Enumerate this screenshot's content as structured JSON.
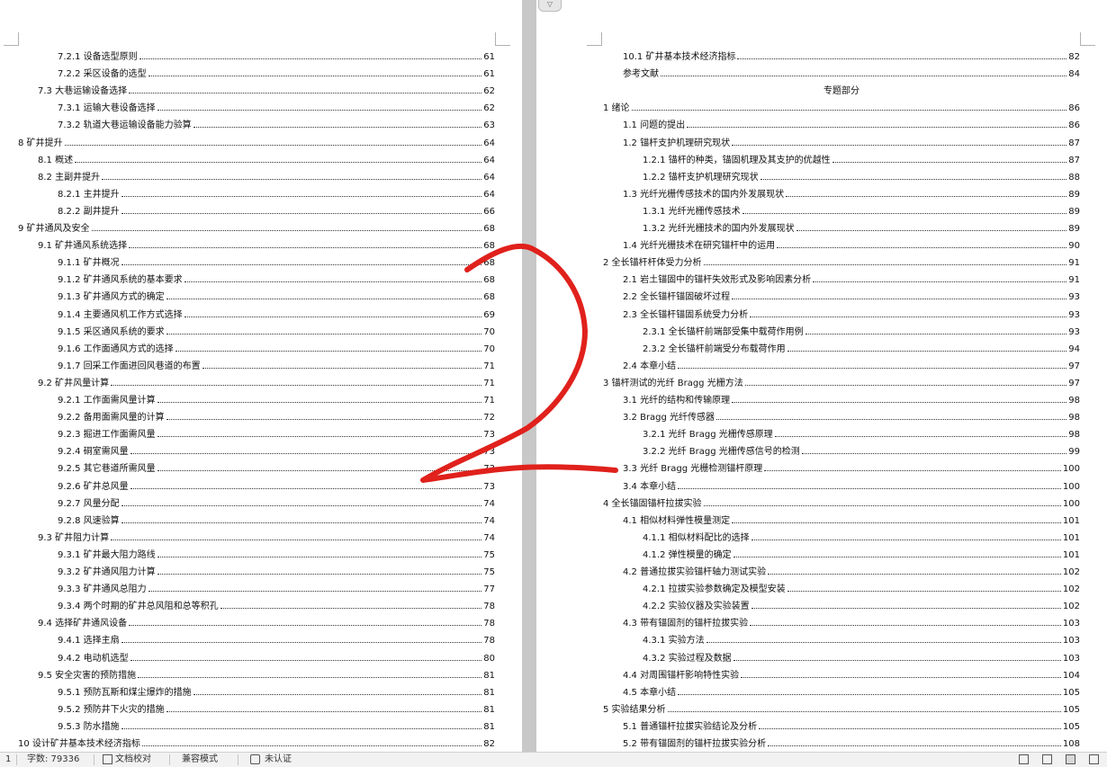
{
  "left_toc": [
    {
      "text": "7.2.1 设备选型原则",
      "page": "61",
      "indent": 2
    },
    {
      "text": "7.2.2 采区设备的选型",
      "page": "61",
      "indent": 2
    },
    {
      "text": "7.3 大巷运输设备选择",
      "page": "62",
      "indent": 1
    },
    {
      "text": "7.3.1 运输大巷设备选择",
      "page": "62",
      "indent": 2
    },
    {
      "text": "7.3.2 轨道大巷运输设备能力验算",
      "page": "63",
      "indent": 2
    },
    {
      "text": "8 矿井提升",
      "page": "64",
      "indent": 0
    },
    {
      "text": "8.1 概述",
      "page": "64",
      "indent": 1
    },
    {
      "text": "8.2 主副井提升",
      "page": "64",
      "indent": 1
    },
    {
      "text": "8.2.1 主井提升",
      "page": "64",
      "indent": 2
    },
    {
      "text": "8.2.2 副井提升",
      "page": "66",
      "indent": 2
    },
    {
      "text": "9 矿井通风及安全",
      "page": "68",
      "indent": 0
    },
    {
      "text": "9.1 矿井通风系统选择",
      "page": "68",
      "indent": 1
    },
    {
      "text": "9.1.1 矿井概况",
      "page": "68",
      "indent": 2
    },
    {
      "text": "9.1.2 矿井通风系统的基本要求",
      "page": "68",
      "indent": 2
    },
    {
      "text": "9.1.3 矿井通风方式的确定",
      "page": "68",
      "indent": 2
    },
    {
      "text": "9.1.4 主要通风机工作方式选择",
      "page": "69",
      "indent": 2
    },
    {
      "text": "9.1.5 采区通风系统的要求",
      "page": "70",
      "indent": 2
    },
    {
      "text": "9.1.6 工作面通风方式的选择",
      "page": "70",
      "indent": 2
    },
    {
      "text": "9.1.7   回采工作面进回风巷道的布置",
      "page": "71",
      "indent": 2
    },
    {
      "text": "9.2 矿井风量计算",
      "page": "71",
      "indent": 1
    },
    {
      "text": "9.2.1 工作面需风量计算",
      "page": "71",
      "indent": 2
    },
    {
      "text": "9.2.2 备用面需风量的计算",
      "page": "72",
      "indent": 2
    },
    {
      "text": "9.2.3 掘进工作面需风量",
      "page": "73",
      "indent": 2
    },
    {
      "text": "9.2.4 硐室需风量",
      "page": "73",
      "indent": 2
    },
    {
      "text": "9.2.5 其它巷道所需风量",
      "page": "73",
      "indent": 2
    },
    {
      "text": "9.2.6 矿井总风量",
      "page": "73",
      "indent": 2
    },
    {
      "text": "9.2.7 风量分配",
      "page": "74",
      "indent": 2
    },
    {
      "text": "9.2.8 风速验算",
      "page": "74",
      "indent": 2
    },
    {
      "text": "9.3 矿井阻力计算",
      "page": "74",
      "indent": 1
    },
    {
      "text": "9.3.1 矿井最大阻力路线",
      "page": "75",
      "indent": 2
    },
    {
      "text": "9.3.2 矿井通风阻力计算",
      "page": "75",
      "indent": 2
    },
    {
      "text": "9.3.3 矿井通风总阻力",
      "page": "77",
      "indent": 2
    },
    {
      "text": "9.3.4 两个时期的矿井总风阻和总等积孔",
      "page": "78",
      "indent": 2
    },
    {
      "text": "9.4 选择矿井通风设备",
      "page": "78",
      "indent": 1
    },
    {
      "text": "9.4.1 选择主扇",
      "page": "78",
      "indent": 2
    },
    {
      "text": "9.4.2 电动机选型",
      "page": "80",
      "indent": 2
    },
    {
      "text": "9.5 安全灾害的预防措施",
      "page": "81",
      "indent": 1
    },
    {
      "text": "9.5.1 预防瓦斯和煤尘爆炸的措施",
      "page": "81",
      "indent": 2
    },
    {
      "text": "9.5.2 预防井下火灾的措施",
      "page": "81",
      "indent": 2
    },
    {
      "text": "9.5.3 防水措施",
      "page": "81",
      "indent": 2
    },
    {
      "text": "10  设计矿井基本技术经济指标",
      "page": "82",
      "indent": 0
    }
  ],
  "right_toc": [
    {
      "text": "10.1 矿井基本技术经济指标",
      "page": "82",
      "indent": 1
    },
    {
      "text": "参考文献",
      "page": "84",
      "indent": 1
    },
    {
      "text": "专题部分",
      "page": "",
      "indent": -1
    },
    {
      "text": "1 绪论",
      "page": "86",
      "indent": 0
    },
    {
      "text": "1.1 问题的提出",
      "page": "86",
      "indent": 1
    },
    {
      "text": "1.2 锚杆支护机理研究现状",
      "page": "87",
      "indent": 1
    },
    {
      "text": "1.2.1 锚杆的种类，锚固机理及其支护的优越性",
      "page": "87",
      "indent": 2
    },
    {
      "text": "1.2.2 锚杆支护机理研究现状",
      "page": "88",
      "indent": 2
    },
    {
      "text": "1.3 光纤光栅传感技术的国内外发展现状",
      "page": "89",
      "indent": 1
    },
    {
      "text": "1.3.1 光纤光栅传感技术",
      "page": "89",
      "indent": 2
    },
    {
      "text": "1.3.2 光纤光栅技术的国内外发展现状",
      "page": "89",
      "indent": 2
    },
    {
      "text": "1.4 光纤光栅技术在研究锚杆中的运用",
      "page": "90",
      "indent": 1
    },
    {
      "text": "2 全长锚杆杆体受力分析",
      "page": "91",
      "indent": 0
    },
    {
      "text": "2.1 岩土锚固中的锚杆失效形式及影响因素分析",
      "page": "91",
      "indent": 1
    },
    {
      "text": "2.2 全长锚杆锚固破坏过程",
      "page": "93",
      "indent": 1
    },
    {
      "text": "2.3 全长锚杆锚固系统受力分析",
      "page": "93",
      "indent": 1
    },
    {
      "text": "2.3.1 全长锚杆前端部受集中载荷作用例",
      "page": "93",
      "indent": 2
    },
    {
      "text": "2.3.2 全长锚杆前端受分布载荷作用",
      "page": "94",
      "indent": 2
    },
    {
      "text": "2.4 本章小结",
      "page": "97",
      "indent": 1
    },
    {
      "text": "3 锚杆测试的光纤 Bragg 光栅方法",
      "page": "97",
      "indent": 0
    },
    {
      "text": "3.1 光纤的结构和传输原理",
      "page": "98",
      "indent": 1
    },
    {
      "text": "3.2 Bragg 光纤传感器",
      "page": "98",
      "indent": 1
    },
    {
      "text": "3.2.1 光纤 Bragg 光栅传感原理",
      "page": "98",
      "indent": 2
    },
    {
      "text": "3.2.2 光纤 Bragg 光栅传感信号的检测",
      "page": "99",
      "indent": 2
    },
    {
      "text": "3.3 光纤 Bragg 光栅检测锚杆原理",
      "page": "100",
      "indent": 1
    },
    {
      "text": "3.4 本章小结",
      "page": "100",
      "indent": 1
    },
    {
      "text": "4 全长锚固锚杆拉拔实验",
      "page": "100",
      "indent": 0
    },
    {
      "text": "4.1 相似材料弹性模量测定",
      "page": "101",
      "indent": 1
    },
    {
      "text": "4.1.1 相似材料配比的选择",
      "page": "101",
      "indent": 2
    },
    {
      "text": "4.1.2 弹性模量的确定",
      "page": "101",
      "indent": 2
    },
    {
      "text": "4.2 普通拉拔实验锚杆轴力测试实验",
      "page": "102",
      "indent": 1
    },
    {
      "text": "4.2.1 拉拔实验参数确定及模型安装",
      "page": "102",
      "indent": 2
    },
    {
      "text": "4.2.2 实验仪器及实验装置",
      "page": "102",
      "indent": 2
    },
    {
      "text": "4.3 带有锚固剂的锚杆拉拔实验",
      "page": "103",
      "indent": 1
    },
    {
      "text": "4.3.1 实验方法",
      "page": "103",
      "indent": 2
    },
    {
      "text": "4.3.2 实验过程及数据",
      "page": "103",
      "indent": 2
    },
    {
      "text": "4.4 对周围锚杆影响特性实验",
      "page": "104",
      "indent": 1
    },
    {
      "text": "4.5 本章小结",
      "page": "105",
      "indent": 1
    },
    {
      "text": "5 实验结果分析",
      "page": "105",
      "indent": 0
    },
    {
      "text": "5.1 普通锚杆拉拔实验结论及分析",
      "page": "105",
      "indent": 1
    },
    {
      "text": "5.2 带有锚固剂的锚杆拉拔实验分析",
      "page": "108",
      "indent": 1
    }
  ],
  "status_bar": {
    "page_indicator": "1",
    "word_count": "字数: 79336",
    "spell_check": "文档校对",
    "compat_mode": "兼容模式",
    "auth_status": "未认证"
  },
  "colors": {
    "scribble": "#e0211c",
    "page_bg": "#ffffff",
    "desk_bg": "#c4c4c4"
  }
}
